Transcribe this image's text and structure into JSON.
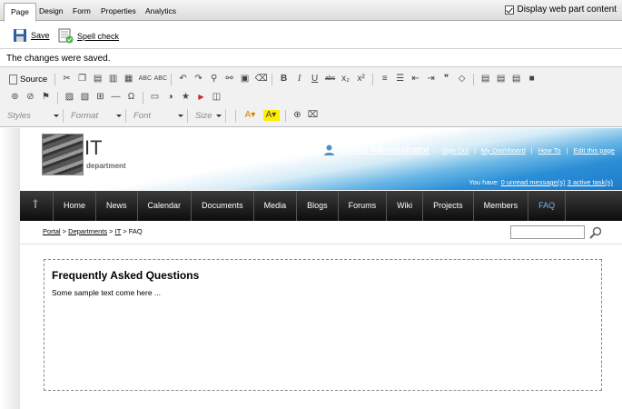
{
  "tabs": [
    "Page",
    "Design",
    "Form",
    "Properties",
    "Analytics"
  ],
  "display_webpart": "Display web part content",
  "save_label": "Save",
  "spellcheck_label": "Spell check",
  "message": "The changes were saved.",
  "editor": {
    "source_label": "Source",
    "styles": "Styles",
    "format": "Format",
    "font": "Font",
    "size": "Size"
  },
  "site": {
    "title": "IT",
    "subtitle": "department",
    "user": "Global Administrator",
    "links": [
      "Sign Out",
      "My Dashboard",
      "How To",
      "Edit this page"
    ],
    "you_have": "You have:",
    "unread": "0 unread message(s)",
    "tasks": "3 active task(s)",
    "nav": [
      "Home",
      "News",
      "Calendar",
      "Documents",
      "Media",
      "Blogs",
      "Forums",
      "Wiki",
      "Projects",
      "Members",
      "FAQ"
    ],
    "breadcrumb": [
      "Portal",
      "Departments",
      "IT",
      "FAQ"
    ],
    "content_title": "Frequently Asked Questions",
    "content_text": "Some sample text come here ..."
  }
}
